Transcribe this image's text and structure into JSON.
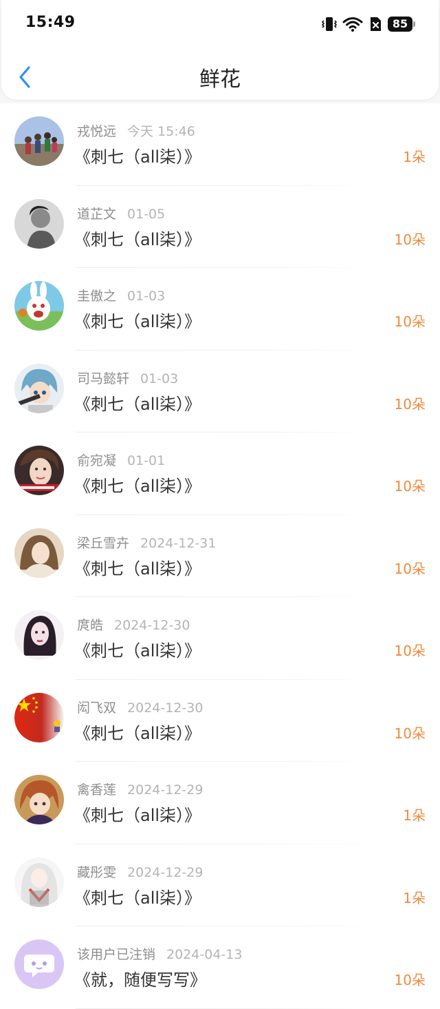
{
  "status_bar": {
    "time": "15:49",
    "battery": "85"
  },
  "header": {
    "title": "鲜花"
  },
  "items": [
    {
      "name": "戎悦远",
      "date": "今天 15:46",
      "book": "《刺七（all柒）》",
      "amount": "1朵",
      "avatar_icon": "avatar-photo-group-icon"
    },
    {
      "name": "道芷文",
      "date": "01-05",
      "book": "《刺七（all柒）》",
      "amount": "10朵",
      "avatar_icon": "avatar-photo-person-icon"
    },
    {
      "name": "圭傲之",
      "date": "01-03",
      "book": "《刺七（all柒）》",
      "amount": "10朵",
      "avatar_icon": "avatar-cartoon-rabbit-icon"
    },
    {
      "name": "司马懿轩",
      "date": "01-03",
      "book": "《刺七（all柒）》",
      "amount": "10朵",
      "avatar_icon": "avatar-anime-character-icon"
    },
    {
      "name": "俞宛凝",
      "date": "01-01",
      "book": "《刺七（all柒）》",
      "amount": "10朵",
      "avatar_icon": "avatar-photo-person-icon"
    },
    {
      "name": "梁丘雪卉",
      "date": "2024-12-31",
      "book": "《刺七（all柒）》",
      "amount": "10朵",
      "avatar_icon": "avatar-photo-person-icon"
    },
    {
      "name": "庹皓",
      "date": "2024-12-30",
      "book": "《刺七（all柒）》",
      "amount": "10朵",
      "avatar_icon": "avatar-photo-person-icon"
    },
    {
      "name": "闳飞双",
      "date": "2024-12-30",
      "book": "《刺七（all柒）》",
      "amount": "10朵",
      "avatar_icon": "avatar-flag-icon"
    },
    {
      "name": "禽香莲",
      "date": "2024-12-29",
      "book": "《刺七（all柒）》",
      "amount": "1朵",
      "avatar_icon": "avatar-anime-character-icon"
    },
    {
      "name": "藏彤雯",
      "date": "2024-12-29",
      "book": "《刺七（all柒）》",
      "amount": "1朵",
      "avatar_icon": "avatar-anime-character-icon"
    },
    {
      "name": "该用户已注销",
      "date": "2024-04-13",
      "book": "《就，随便写写》",
      "amount": "10朵",
      "avatar_icon": "avatar-default-chat-icon"
    }
  ],
  "colors": {
    "accent": "#2f8ff0",
    "amount": "#f08a3c",
    "background": "#f6f6f6"
  }
}
